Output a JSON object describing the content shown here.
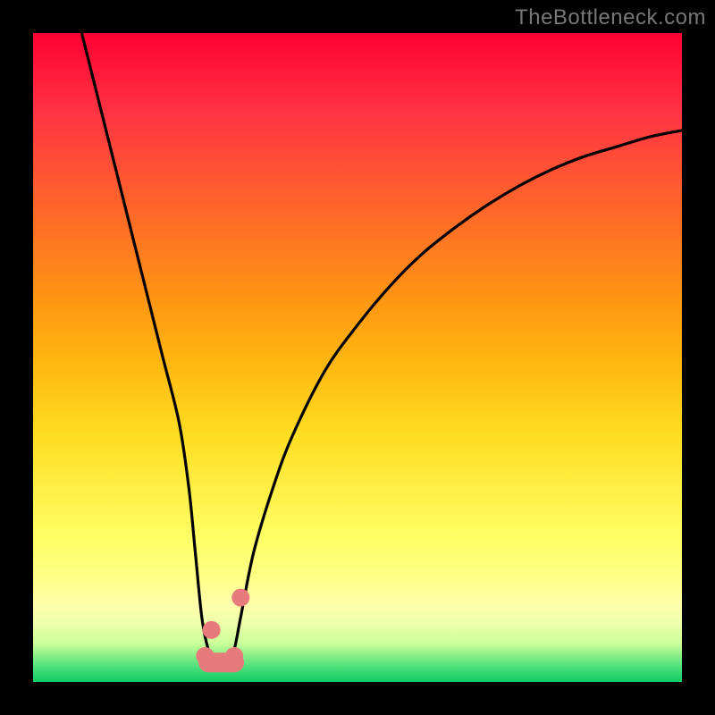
{
  "watermark": "TheBottleneck.com",
  "chart_data": {
    "type": "line",
    "title": "",
    "xlabel": "",
    "ylabel": "",
    "x_range": [
      0,
      100
    ],
    "y_range": [
      0,
      100
    ],
    "grid": false,
    "series": [
      {
        "name": "curve",
        "x": [
          7.5,
          10,
          12.5,
          15,
          17.5,
          20,
          22.5,
          24,
          25,
          26,
          27,
          28,
          29,
          30,
          31,
          32,
          34,
          37,
          40,
          45,
          50,
          55,
          60,
          65,
          70,
          75,
          80,
          85,
          90,
          95,
          100
        ],
        "y": [
          100,
          90,
          80,
          70,
          60,
          50,
          40,
          30,
          20,
          10,
          5,
          3,
          3,
          3,
          5,
          10,
          20,
          30,
          38,
          48,
          55,
          61,
          66,
          70,
          73.5,
          76.5,
          79,
          81,
          82.5,
          84,
          85
        ]
      }
    ],
    "flat_region": {
      "x_start": 27,
      "x_end": 31,
      "y": 3
    },
    "markers": [
      {
        "x": 27.5,
        "y": 8
      },
      {
        "x": 32,
        "y": 13
      },
      {
        "x": 26.5,
        "y": 4
      },
      {
        "x": 28,
        "y": 3
      },
      {
        "x": 29.5,
        "y": 3
      },
      {
        "x": 31,
        "y": 4
      }
    ],
    "background_gradient": {
      "type": "vertical",
      "stops": [
        {
          "pos": 0,
          "color": "#ff0033"
        },
        {
          "pos": 50,
          "color": "#ffbb11"
        },
        {
          "pos": 80,
          "color": "#ffff66"
        },
        {
          "pos": 100,
          "color": "#11cc66"
        }
      ]
    }
  }
}
